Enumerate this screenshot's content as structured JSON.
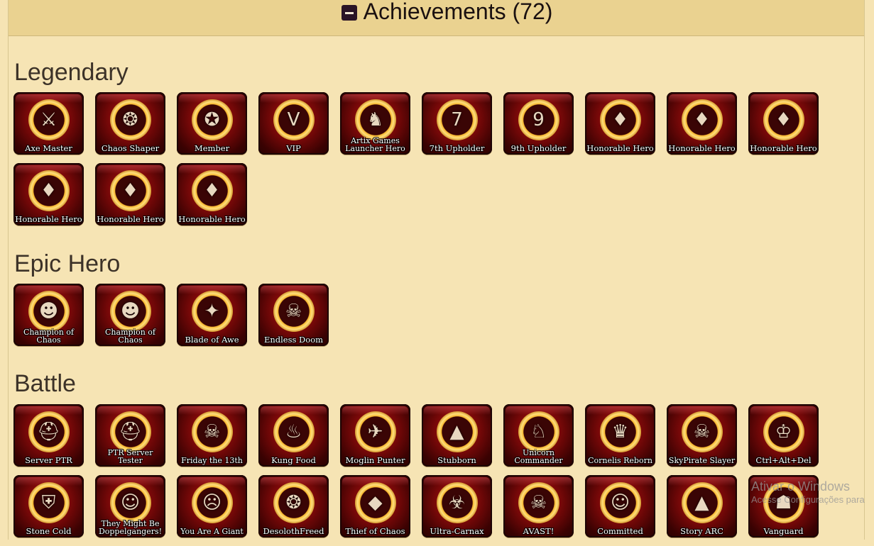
{
  "header": {
    "title": "Achievements (72)"
  },
  "sections": [
    {
      "title": "Legendary",
      "badges": [
        {
          "label": "Axe Master",
          "icon": "axe-icon",
          "glyph": "⚔"
        },
        {
          "label": "Chaos Shaper",
          "icon": "dragon-icon",
          "glyph": "❂"
        },
        {
          "label": "Member",
          "icon": "member-emblem-icon",
          "glyph": "✪"
        },
        {
          "label": "VIP",
          "icon": "vip-icon",
          "glyph": "V"
        },
        {
          "label": "Artix Games Launcher Hero",
          "icon": "knight-icon",
          "glyph": "♞"
        },
        {
          "label": "7th Upholder",
          "icon": "upholder-7-icon",
          "glyph": "7"
        },
        {
          "label": "9th Upholder",
          "icon": "upholder-9-icon",
          "glyph": "9"
        },
        {
          "label": "Honorable Hero",
          "icon": "dragon-head-icon",
          "glyph": "♦"
        },
        {
          "label": "Honorable Hero",
          "icon": "dragon-head-icon",
          "glyph": "♦"
        },
        {
          "label": "Honorable Hero",
          "icon": "dragon-head-icon",
          "glyph": "♦"
        },
        {
          "label": "Honorable Hero",
          "icon": "dragon-head-icon",
          "glyph": "♦"
        },
        {
          "label": "Honorable Hero",
          "icon": "dragon-head-icon",
          "glyph": "♦"
        },
        {
          "label": "Honorable Hero",
          "icon": "dragon-head-icon",
          "glyph": "♦"
        }
      ]
    },
    {
      "title": "Epic Hero",
      "badges": [
        {
          "label": "Champion of Chaos",
          "icon": "chaos-champion-icon",
          "glyph": "☻"
        },
        {
          "label": "Champion of Chaos",
          "icon": "chaos-champion-icon",
          "glyph": "☻"
        },
        {
          "label": "Blade of Awe",
          "icon": "blade-icon",
          "glyph": "✦"
        },
        {
          "label": "Endless Doom",
          "icon": "skull-icon",
          "glyph": "☠"
        }
      ]
    },
    {
      "title": "Battle",
      "badges": [
        {
          "label": "Server PTR",
          "icon": "helmet-icon",
          "glyph": "⛑"
        },
        {
          "label": "PTR Server Tester",
          "icon": "helmet-icon",
          "glyph": "⛑"
        },
        {
          "label": "Friday the 13th",
          "icon": "skull-icon",
          "glyph": "☠"
        },
        {
          "label": "Kung Food",
          "icon": "turkey-icon",
          "glyph": "♨"
        },
        {
          "label": "Moglin Punter",
          "icon": "boot-icon",
          "glyph": "✈"
        },
        {
          "label": "Stubborn",
          "icon": "rock-icon",
          "glyph": "▲"
        },
        {
          "label": "Unicorn Commander",
          "icon": "unicorn-icon",
          "glyph": "♘"
        },
        {
          "label": "Cornelis Reborn",
          "icon": "gargoyle-icon",
          "glyph": "♛"
        },
        {
          "label": "SkyPirate Slayer",
          "icon": "skull-crossbones-icon",
          "glyph": "☠"
        },
        {
          "label": "Ctrl+Alt+Del",
          "icon": "crown-icon",
          "glyph": "♔"
        },
        {
          "label": "Stone Cold",
          "icon": "helmet-icon",
          "glyph": "⛨"
        },
        {
          "label": "They Might Be Doppelgangers!",
          "icon": "twins-icon",
          "glyph": "☺"
        },
        {
          "label": "You Are A Giant",
          "icon": "orc-icon",
          "glyph": "☹"
        },
        {
          "label": "DesolothFreed",
          "icon": "dragon-icon",
          "glyph": "❂"
        },
        {
          "label": "Thief of Chaos",
          "icon": "gem-icon",
          "glyph": "◆"
        },
        {
          "label": "Ultra-Carnax",
          "icon": "monster-icon",
          "glyph": "☣"
        },
        {
          "label": "AVAST!",
          "icon": "pirate-flag-icon",
          "glyph": "☠"
        },
        {
          "label": "Committed",
          "icon": "portrait-icon",
          "glyph": "☺"
        },
        {
          "label": "Story ARC",
          "icon": "triangle-icon",
          "glyph": "▲"
        },
        {
          "label": "Vanguard",
          "icon": "vanguard-icon",
          "glyph": "☗"
        }
      ]
    }
  ],
  "watermark": {
    "line1": "Ativar o Windows",
    "line2": "Acesse Configurações para"
  }
}
